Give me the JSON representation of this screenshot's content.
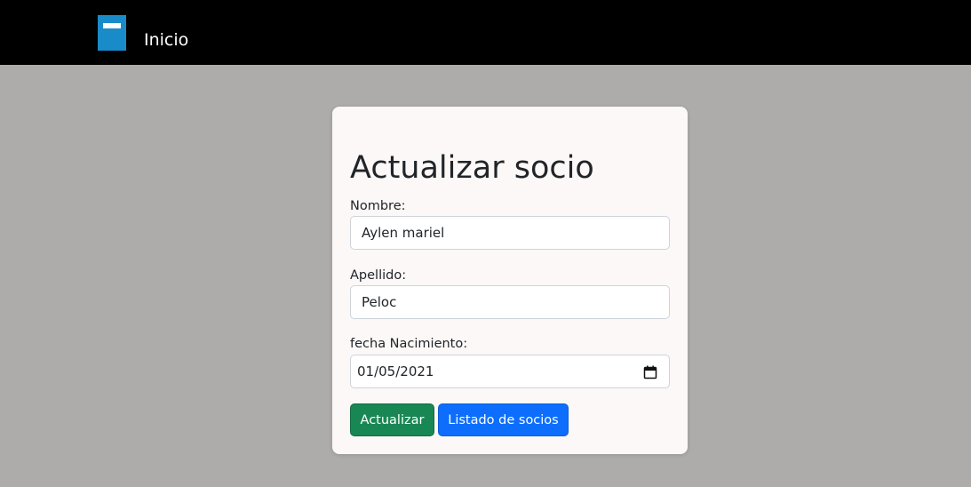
{
  "navbar": {
    "brand_icon": "book-icon",
    "link_label": "Inicio",
    "background": "#000000"
  },
  "form": {
    "title": "Actualizar socio",
    "nombre": {
      "label": "Nombre:",
      "value": "Aylen mariel"
    },
    "apellido": {
      "label": "Apellido:",
      "value": "Peloc"
    },
    "fecha": {
      "label": "fecha Nacimiento:",
      "value": "01/05/2021",
      "icon": "calendar-icon"
    },
    "buttons": {
      "update_label": "Actualizar",
      "list_label": "Listado de socios"
    }
  },
  "colors": {
    "page_background": "#adacaa",
    "card_background": "#fcf8f7",
    "success": "#198754",
    "primary": "#0d6efd",
    "brand_icon": "#1a8bc9"
  }
}
